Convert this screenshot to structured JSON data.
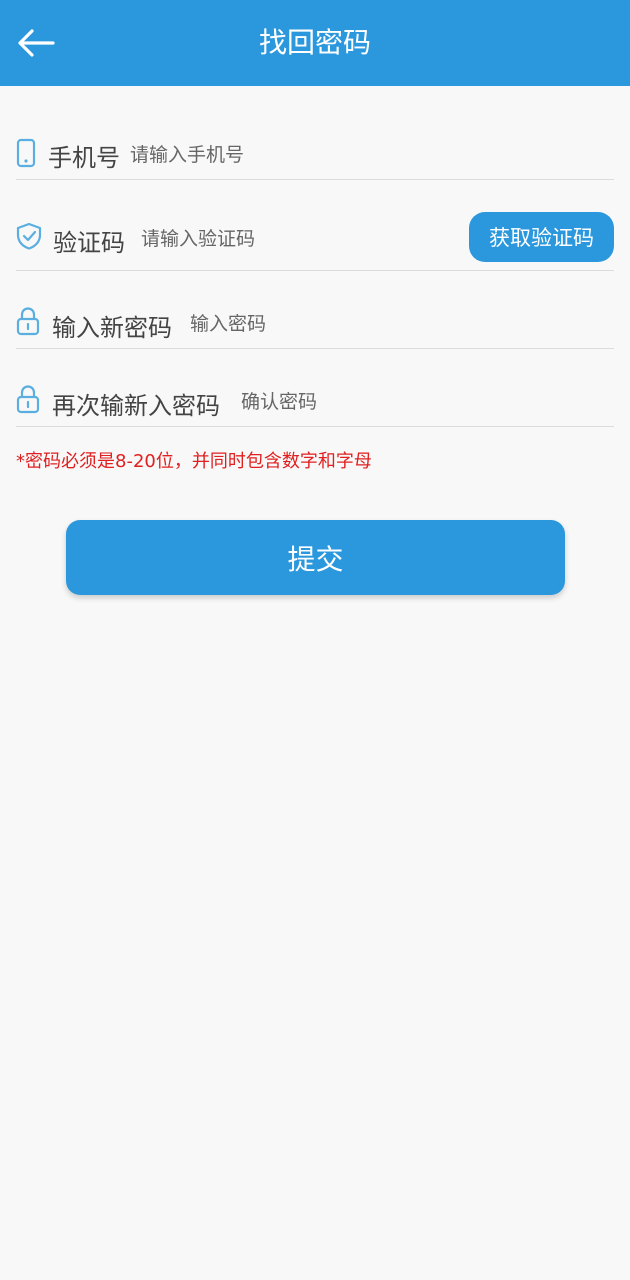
{
  "header": {
    "title": "找回密码",
    "back_icon": "arrow-left-icon"
  },
  "form": {
    "phone": {
      "label": "手机号",
      "placeholder": "请输入手机号",
      "value": "",
      "icon": "phone-icon"
    },
    "code": {
      "label": "验证码",
      "placeholder": "请输入验证码",
      "value": "",
      "icon": "shield-check-icon",
      "button_label": "获取验证码"
    },
    "new_password": {
      "label": "输入新密码",
      "placeholder": "输入密码",
      "value": "",
      "icon": "lock-icon"
    },
    "confirm_password": {
      "label": "再次输新入密码",
      "placeholder": "确认密码",
      "value": "",
      "icon": "lock-icon"
    },
    "hint": "*密码必须是8-20位，并同时包含数字和字母",
    "submit_label": "提交"
  },
  "colors": {
    "accent": "#2b98de",
    "background": "#f8f8f8",
    "hint": "#e02020",
    "icon": "#5aaee0"
  }
}
